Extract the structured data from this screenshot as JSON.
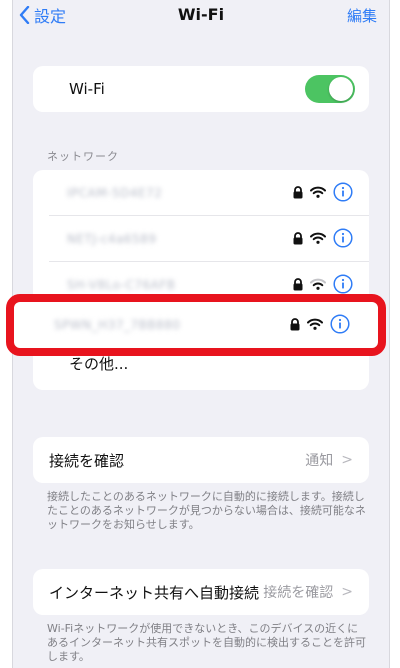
{
  "nav": {
    "back_label": "設定",
    "title": "Wi-Fi",
    "edit_label": "編集"
  },
  "wifi": {
    "label": "Wi-Fi",
    "enabled": true,
    "toggle_color": "#4cc462"
  },
  "networks_header": "ネットワーク",
  "networks": [
    {
      "name": "IPCAM-5D4E72",
      "secure": true,
      "signal": "full",
      "icon": "wifi-icon"
    },
    {
      "name": "NETJ-c4a6589",
      "secure": true,
      "signal": "full",
      "icon": "wifi-icon"
    },
    {
      "name": "SH-V8Lo-C76AFB",
      "secure": true,
      "signal": "medium",
      "icon": "wifi-icon"
    },
    {
      "name": "SPWN_H37_7BB880",
      "secure": true,
      "signal": "full",
      "icon": "wifi-icon",
      "highlighted": true
    }
  ],
  "other_label": "その他...",
  "ask_to_join": {
    "label": "接続を確認",
    "value": "通知",
    "footnote": "接続したことのあるネットワークに自動的に接続します。接続したことのあるネットワークが見つからない場合は、接続可能なネットワークをお知らせします。"
  },
  "auto_join_hotspot": {
    "label": "インターネット共有へ自動接続",
    "value": "接続を確認",
    "footnote": "Wi-Fiネットワークが使用できないとき、このデバイスの近くにあるインターネット共有スポットを自動的に検出することを許可します。"
  },
  "colors": {
    "accent": "#2f7cf6",
    "highlight": "#e8141e",
    "background": "#f0f0f6"
  }
}
